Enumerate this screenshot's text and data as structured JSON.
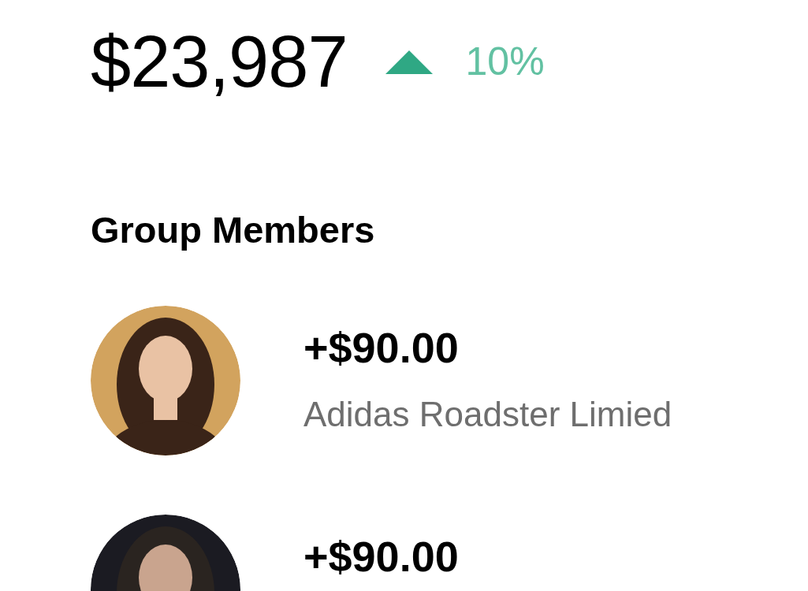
{
  "total": {
    "amount": "$23,987",
    "rising": true,
    "change": "10%"
  },
  "section_title": "Group Members",
  "members": [
    {
      "amount": "+$90.00",
      "name": "Adidas Roadster Limied"
    },
    {
      "amount": "+$90.00"
    }
  ]
}
